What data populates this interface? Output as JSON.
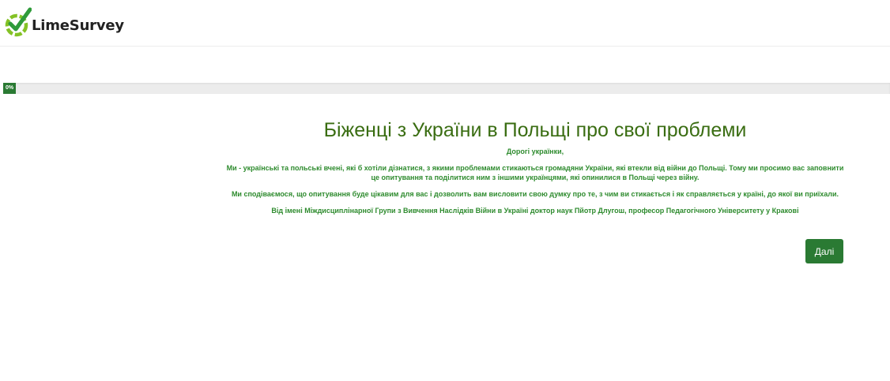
{
  "header": {
    "logo_text": "LimeSurvey",
    "logo_icon": "limesurvey-logo-icon"
  },
  "progress": {
    "label": "0%",
    "value_percent": 0,
    "color": "#2a7a33"
  },
  "survey": {
    "title": "Біженці з України в Польщі про свої проблеми",
    "paragraphs": [
      "Дорогі українки,",
      "Ми - українські та польські вчені, які б хотіли дізнатися, з якими проблемами стикаються громадяни України, які втекли від війни до Польщі. Тому ми просимо вас заповнити це опитування та поділитися ним з іншими українцями, які опинилися в Польщі через війну.",
      "Ми сподіваємося, що опитування буде цікавим для вас і дозволить вам висловити свою думку про те, з чим ви стикається і як справляється у країні, до якої ви приїхали.",
      "Від імені Міждисциплінарної Групи з Вивчення Наслідків Війни в Україні доктор наук Пйотр Длугош, професор Педагогічного Університету у Кракові"
    ],
    "title_color": "#3a6d12",
    "text_color": "#2e8b2e"
  },
  "navigation": {
    "next_label": "Далі",
    "button_color": "#2a7a33"
  }
}
